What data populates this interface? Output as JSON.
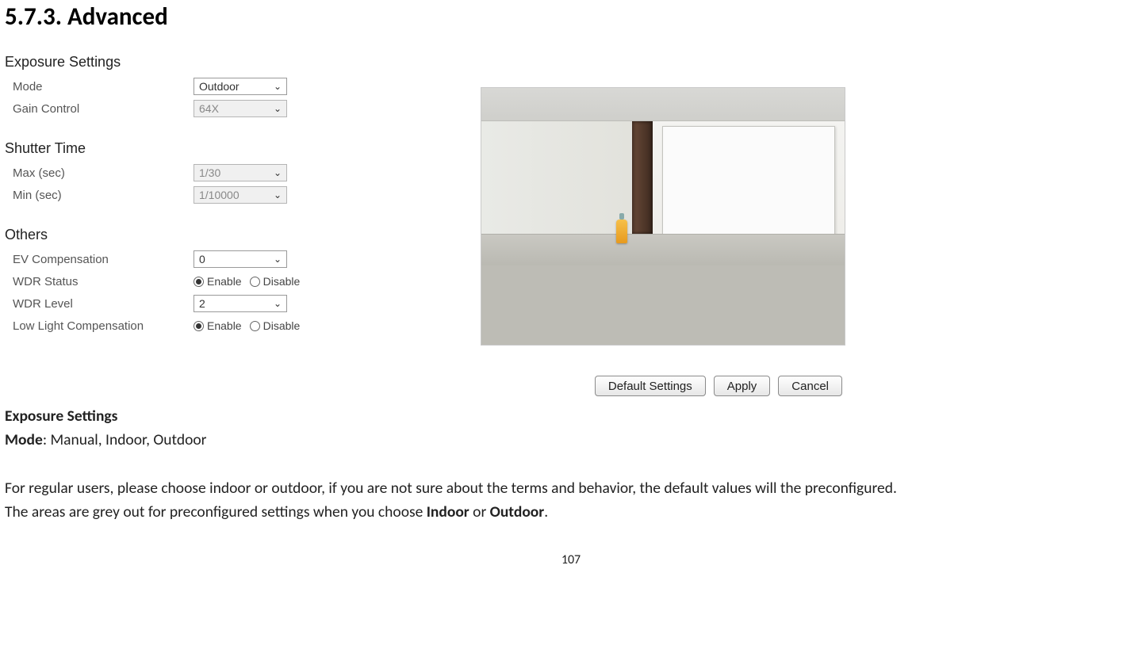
{
  "section_title": "5.7.3. Advanced",
  "left": {
    "exposure_title": "Exposure Settings",
    "mode_label": "Mode",
    "mode_value": "Outdoor",
    "gain_label": "Gain Control",
    "gain_value": "64X",
    "shutter_title": "Shutter Time",
    "max_label": "Max (sec)",
    "max_value": "1/30",
    "min_label": "Min (sec)",
    "min_value": "1/10000",
    "others_title": "Others",
    "ev_label": "EV Compensation",
    "ev_value": "0",
    "wdr_status_label": "WDR Status",
    "wdr_level_label": "WDR Level",
    "wdr_level_value": "2",
    "llc_label": "Low Light Compensation",
    "radio_enable": "Enable",
    "radio_disable": "Disable"
  },
  "buttons": {
    "default": "Default Settings",
    "apply": "Apply",
    "cancel": "Cancel"
  },
  "body": {
    "exp_heading": "Exposure Settings",
    "mode_prefix": "Mode",
    "mode_rest": ": Manual, Indoor, Outdoor",
    "para1": "For regular users, please choose indoor or outdoor, if you are not sure about the terms and behavior, the default values will the preconfigured.",
    "para2_pre": "The areas are grey out for preconfigured settings when you choose ",
    "para2_b1": "Indoor",
    "para2_mid": " or ",
    "para2_b2": "Outdoor",
    "para2_post": "."
  },
  "page_number": "107"
}
